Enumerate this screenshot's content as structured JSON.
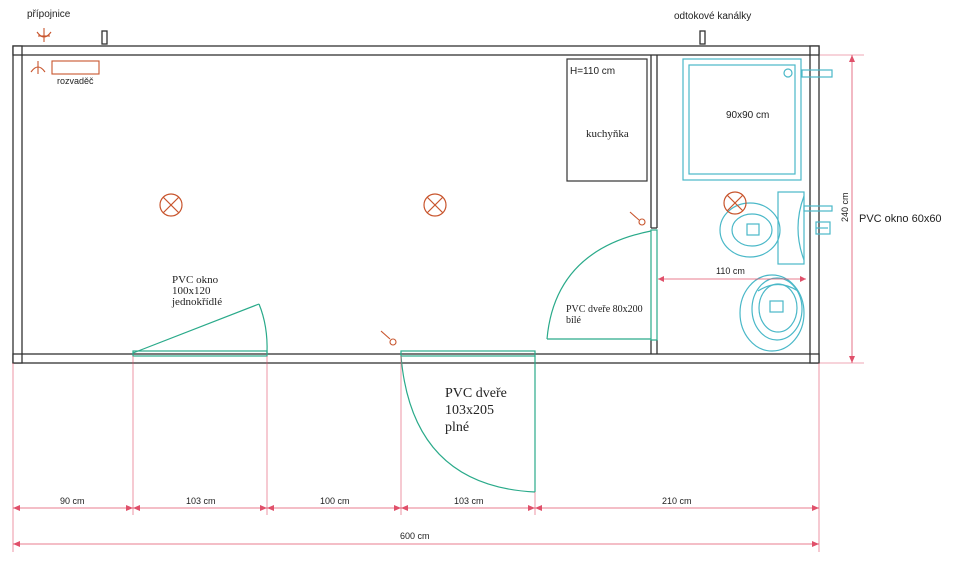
{
  "labels": {
    "pripojnice": "přípojnice",
    "odtokove": "odtokové kanálky",
    "rozvadec": "rozvaděč",
    "h110": "H=110 cm",
    "kuchynka": "kuchyňka",
    "shower": "90x90 cm",
    "w110": "110 cm",
    "h240": "240 cm",
    "window_right": "PVC okno 60x60",
    "window_front": [
      "PVC okno",
      "100x120",
      "jednokřídlé"
    ],
    "inner_door": [
      "PVC dveře 80x200",
      "bílé"
    ],
    "main_door": [
      "PVC dveře",
      "103x205",
      "plné"
    ]
  },
  "dimensions": {
    "d1": "90 cm",
    "d2": "103 cm",
    "d3": "100 cm",
    "d4": "103 cm",
    "d5": "210 cm",
    "total": "600 cm"
  },
  "colors": {
    "wall": "#333333",
    "green": "#2aaa8a",
    "cyan": "#4ab8c8",
    "red": "#c8552d",
    "dim": "#e0506a"
  }
}
